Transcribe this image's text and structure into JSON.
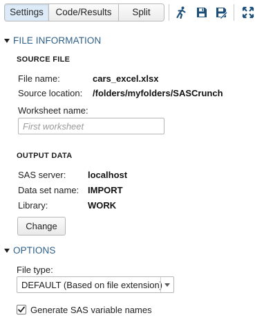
{
  "toolbar": {
    "tabs": [
      {
        "label": "Settings",
        "active": true
      },
      {
        "label": "Code/Results",
        "active": false
      },
      {
        "label": "Split",
        "active": false
      }
    ],
    "icons": [
      "run-icon",
      "save-icon",
      "save-as-icon",
      "maximize-icon"
    ],
    "accent": "#2c5f8a",
    "active_tab_bg": "#dcebf7"
  },
  "file_information": {
    "title": "FILE INFORMATION",
    "source_file": {
      "heading": "SOURCE FILE",
      "file_name_label": "File name:",
      "file_name_value": "cars_excel.xlsx",
      "source_location_label": "Source location:",
      "source_location_value": "/folders/myfolders/SASCrunch",
      "worksheet_label": "Worksheet name:",
      "worksheet_placeholder": "First worksheet",
      "worksheet_value": ""
    },
    "output_data": {
      "heading": "OUTPUT DATA",
      "sas_server_label": "SAS server:",
      "sas_server_value": "localhost",
      "data_set_label": "Data set name:",
      "data_set_value": "IMPORT",
      "library_label": "Library:",
      "library_value": "WORK",
      "change_button": "Change"
    }
  },
  "options": {
    "title": "OPTIONS",
    "file_type_label": "File type:",
    "file_type_value": "DEFAULT (Based on file extension)",
    "generate_names_label": "Generate SAS variable names",
    "generate_names_checked": true
  }
}
